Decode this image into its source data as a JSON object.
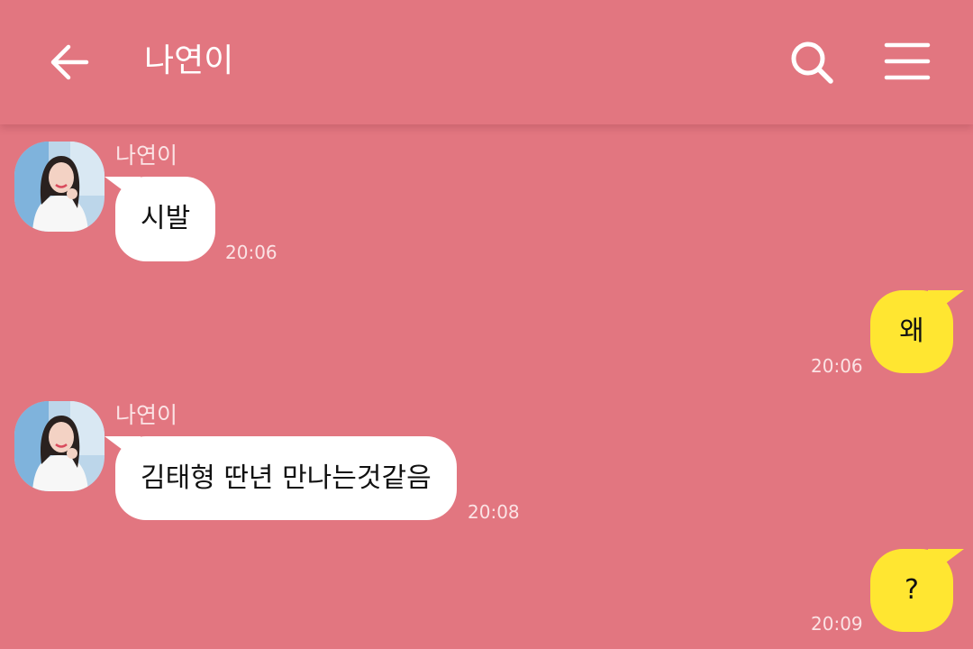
{
  "header": {
    "title": "나연이",
    "back_icon": "back-arrow-icon",
    "search_icon": "search-icon",
    "menu_icon": "hamburger-menu-icon"
  },
  "colors": {
    "background": "#e27680",
    "incoming_bubble": "#ffffff",
    "outgoing_bubble": "#ffe631",
    "meta_text": "#fbe3e5"
  },
  "messages": [
    {
      "direction": "in",
      "sender": "나연이",
      "text": "시발",
      "time": "20:06"
    },
    {
      "direction": "out",
      "text": "왜",
      "time": "20:06"
    },
    {
      "direction": "in",
      "sender": "나연이",
      "text": "김태형 딴년 만나는것같음",
      "time": "20:08"
    },
    {
      "direction": "out",
      "text": "?",
      "time": "20:09"
    }
  ]
}
